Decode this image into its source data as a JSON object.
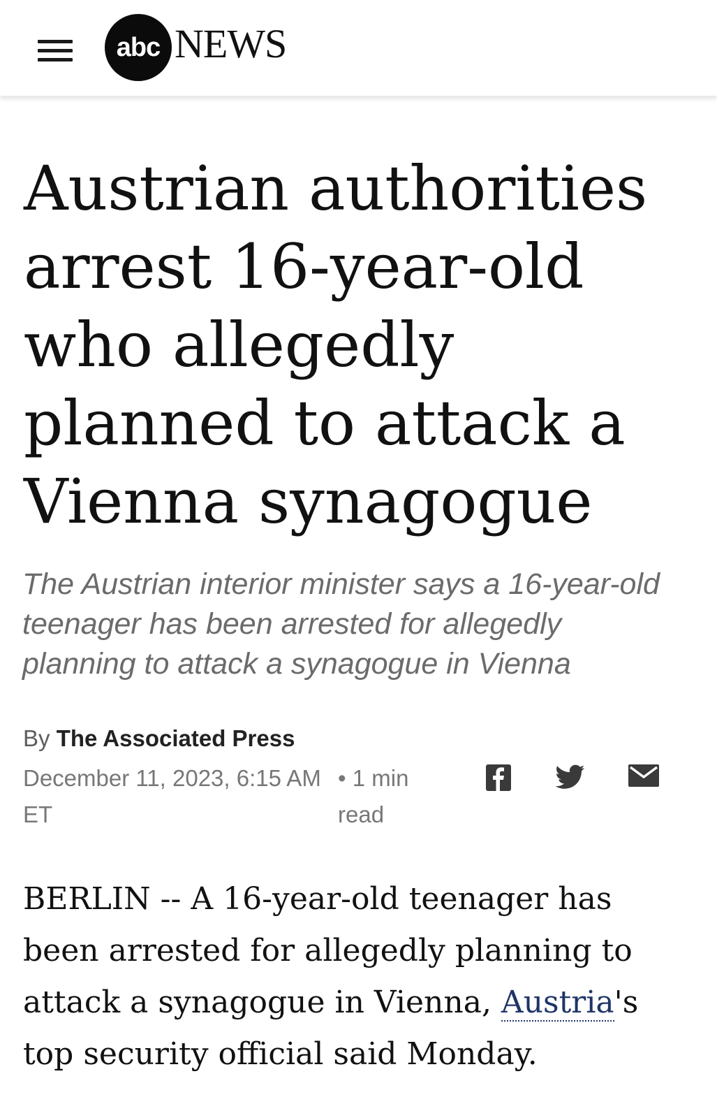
{
  "header": {
    "menu_icon": "hamburger-menu-icon",
    "logo": {
      "circle_text": "abc",
      "wordmark": "NEWS"
    }
  },
  "article": {
    "headline": "Austrian authorities arrest 16-year-old who allegedly planned to attack a Vienna synagogue",
    "subheadline": "The Austrian interior minister says a 16-year-old teenager has been arrested for allegedly planning to attack a synagogue in Vienna",
    "byline": {
      "prefix": "By",
      "author": "The Associated Press"
    },
    "date": "December 11, 2023, 6:15 AM ET",
    "read_time": "• 1 min read",
    "share": [
      {
        "icon": "facebook-icon"
      },
      {
        "icon": "twitter-icon"
      },
      {
        "icon": "email-icon"
      }
    ],
    "body": {
      "lead": "BERLIN -- A 16-year-old teenager has been arrested for allegedly planning to attack a synagogue in Vienna, ",
      "link": "Austria",
      "rest": "'s top security official said Monday."
    }
  },
  "colors": {
    "link": "#1f3566",
    "subhead": "#6b6b6b",
    "meta": "#777777"
  }
}
